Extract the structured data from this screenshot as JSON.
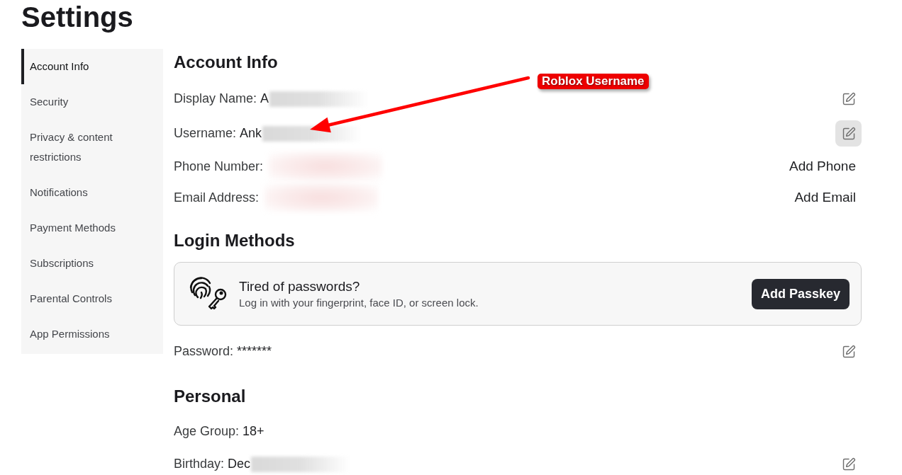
{
  "page_title": "Settings",
  "sidebar": {
    "items": [
      {
        "label": "Account Info",
        "selected": true
      },
      {
        "label": "Security",
        "selected": false
      },
      {
        "label": "Privacy & content restrictions",
        "selected": false
      },
      {
        "label": "Notifications",
        "selected": false
      },
      {
        "label": "Payment Methods",
        "selected": false
      },
      {
        "label": "Subscriptions",
        "selected": false
      },
      {
        "label": "Parental Controls",
        "selected": false
      },
      {
        "label": "App Permissions",
        "selected": false
      }
    ]
  },
  "sections": [
    {
      "title": "Account Info",
      "rows": [
        {
          "label": "Display Name:",
          "value": "A",
          "redaction": {
            "kind": "gray"
          },
          "action": {
            "kind": "edit",
            "hovered": false
          }
        },
        {
          "label": "Username:",
          "value": "Ank",
          "redaction": {
            "kind": "gray"
          },
          "action": {
            "kind": "edit",
            "hovered": true
          }
        },
        {
          "label": "Phone Number:",
          "redaction": {
            "kind": "rose"
          },
          "action": {
            "kind": "link",
            "label": "Add Phone"
          }
        },
        {
          "label": "Email Address:",
          "redaction": {
            "kind": "rose"
          },
          "action": {
            "kind": "link",
            "label": "Add Email"
          }
        }
      ]
    },
    {
      "title": "Login Methods",
      "card": {
        "title": "Tired of passwords?",
        "text": "Log in with your fingerprint, face ID, or screen lock.",
        "button": "Add Passkey"
      },
      "rows": [
        {
          "label": "Password:",
          "value": "*******",
          "action": {
            "kind": "edit",
            "hovered": false
          }
        }
      ]
    },
    {
      "title": "Personal",
      "rows": [
        {
          "label": "Age Group:",
          "value": "18+"
        },
        {
          "label": "Birthday:",
          "value": "Dec",
          "redaction": {
            "kind": "gray"
          },
          "action": {
            "kind": "edit",
            "hovered": false
          }
        }
      ]
    }
  ],
  "annotation": {
    "label": "Roblox Username"
  }
}
